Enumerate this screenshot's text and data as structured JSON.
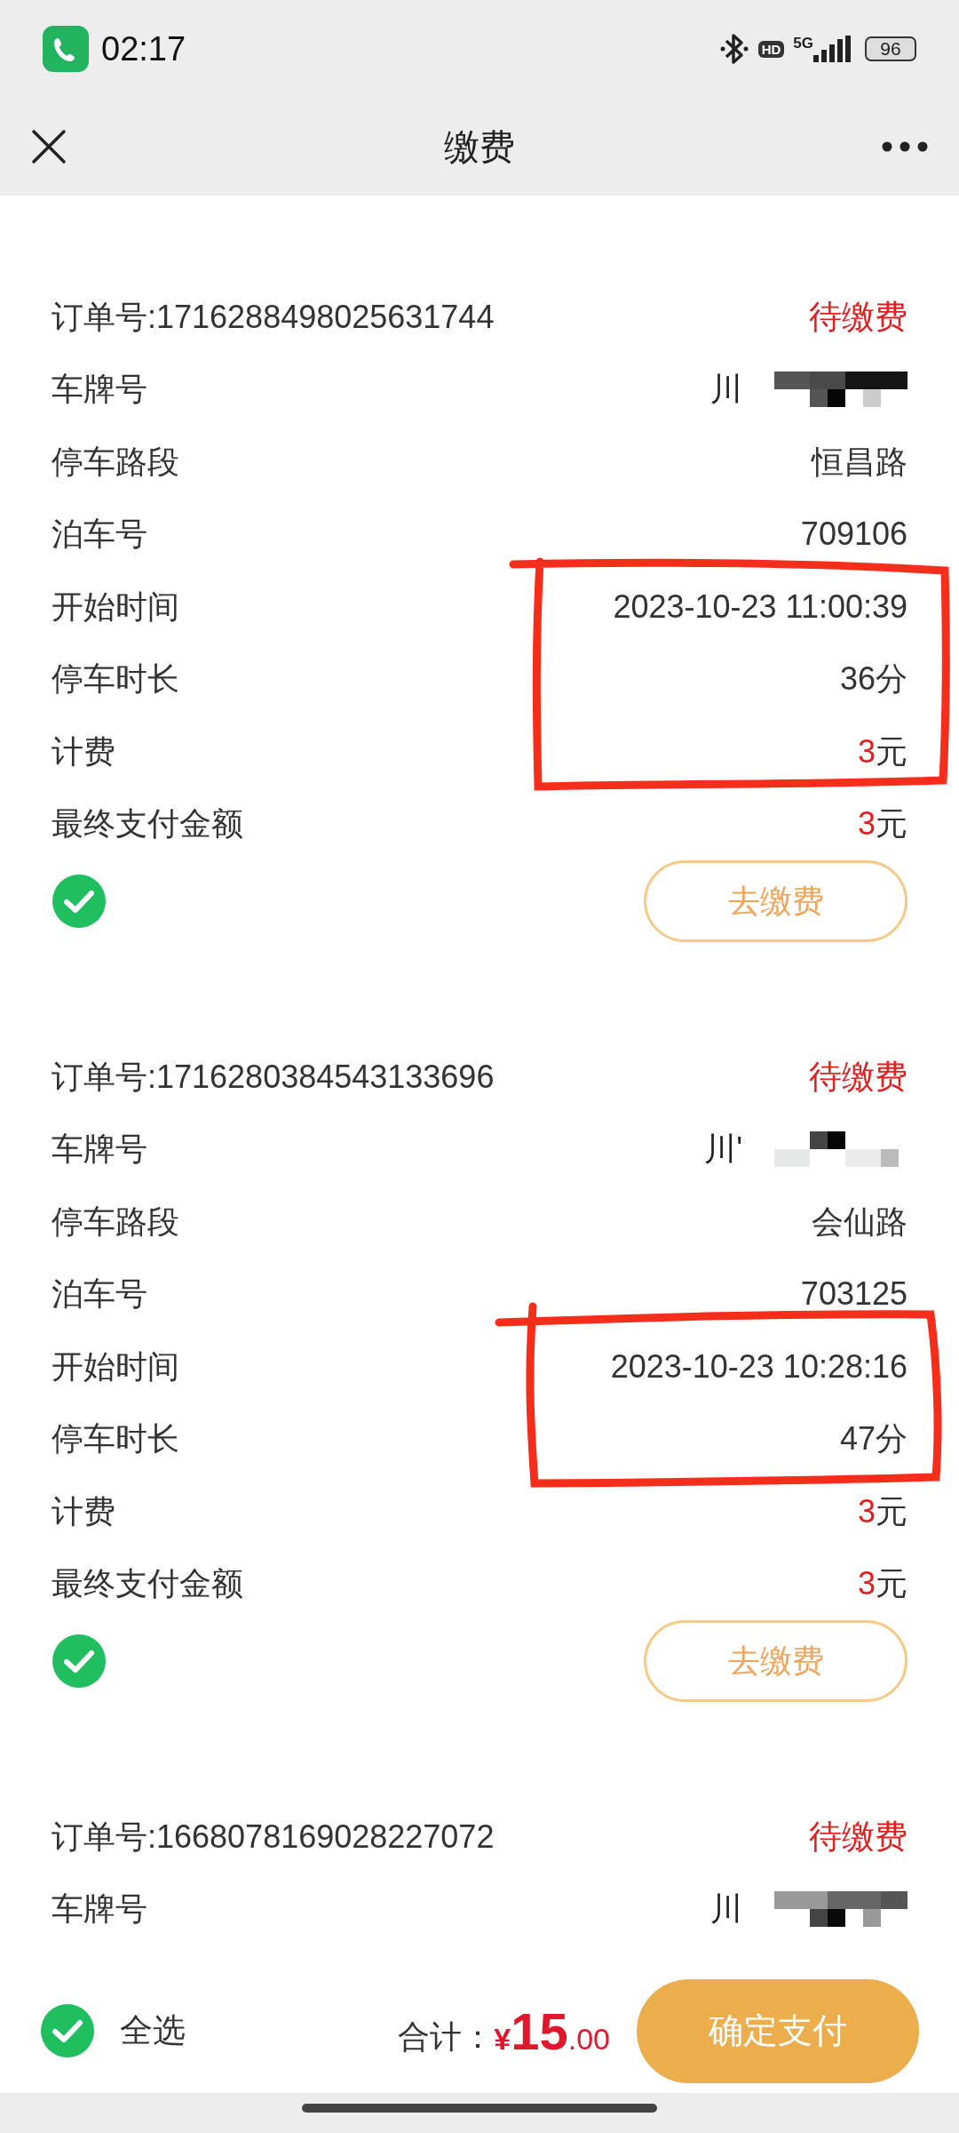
{
  "status_bar": {
    "time": "02:17",
    "hd_badge": "HD",
    "network": "5G",
    "battery": "96"
  },
  "header": {
    "title": "缴费"
  },
  "orders": [
    {
      "order": "订单号:1716288498025631744",
      "status": "待缴费",
      "checked": true,
      "pay_button": "去缴费",
      "fields": [
        {
          "kind": "plate",
          "label": "车牌号",
          "value": "川"
        },
        {
          "kind": "text",
          "label": "停车路段",
          "value": "恒昌路"
        },
        {
          "kind": "text",
          "label": "泊车号",
          "value": "709106"
        },
        {
          "kind": "text",
          "label": "开始时间",
          "value": "2023-10-23 11:00:39"
        },
        {
          "kind": "text",
          "label": "停车时长",
          "value": "36分"
        },
        {
          "kind": "money",
          "label": "计费",
          "amount": "3",
          "unit": "元"
        },
        {
          "kind": "money",
          "label": "最终支付金额",
          "amount": "3",
          "unit": "元"
        }
      ]
    },
    {
      "order": "订单号:1716280384543133696",
      "status": "待缴费",
      "checked": true,
      "pay_button": "去缴费",
      "fields": [
        {
          "kind": "plate",
          "label": "车牌号",
          "value": "川'"
        },
        {
          "kind": "text",
          "label": "停车路段",
          "value": "会仙路"
        },
        {
          "kind": "text",
          "label": "泊车号",
          "value": "703125"
        },
        {
          "kind": "text",
          "label": "开始时间",
          "value": "2023-10-23 10:28:16"
        },
        {
          "kind": "text",
          "label": "停车时长",
          "value": "47分"
        },
        {
          "kind": "money",
          "label": "计费",
          "amount": "3",
          "unit": "元"
        },
        {
          "kind": "money",
          "label": "最终支付金额",
          "amount": "3",
          "unit": "元"
        }
      ]
    },
    {
      "order": "订单号:1668078169028227072",
      "status": "待缴费",
      "fields": [
        {
          "kind": "plate",
          "label": "车牌号",
          "value": "川"
        }
      ]
    }
  ],
  "footer": {
    "select_all": {
      "label": "全选",
      "checked": true
    },
    "total_label": "合计：",
    "currency": "¥",
    "total_integer": "15",
    "total_decimals": ".00",
    "confirm_button": "确定支付"
  }
}
